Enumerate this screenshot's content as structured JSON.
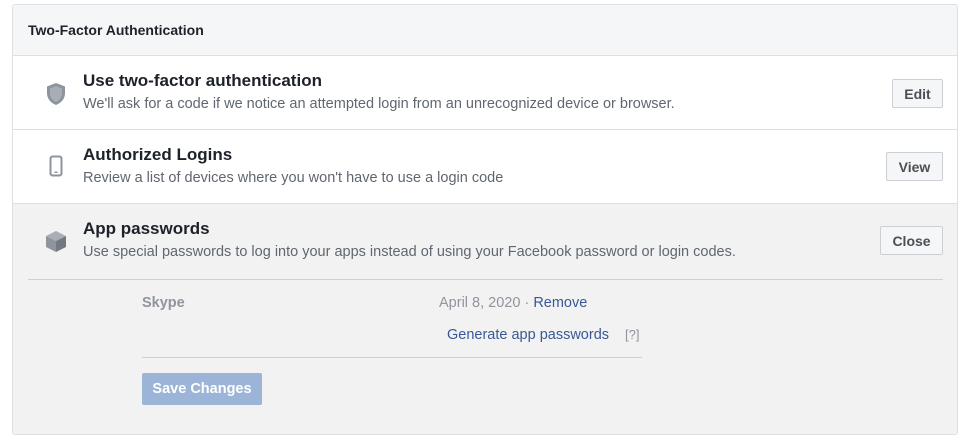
{
  "panel": {
    "title": "Two-Factor Authentication"
  },
  "rows": [
    {
      "icon": "shield-icon",
      "title": "Use two-factor authentication",
      "description": "We'll ask for a code if we notice an attempted login from an unrecognized device or browser.",
      "button": "Edit"
    },
    {
      "icon": "phone-icon",
      "title": "Authorized Logins",
      "description": "Review a list of devices where you won't have to use a login code",
      "button": "View"
    },
    {
      "icon": "cube-icon",
      "title": "App passwords",
      "description": "Use special passwords to log into your apps instead of using your Facebook password or login codes.",
      "button": "Close"
    }
  ],
  "app_passwords": {
    "entries": [
      {
        "name": "Skype",
        "date": "April 8, 2020",
        "separator": " · ",
        "remove_label": "Remove"
      }
    ],
    "generate_label": "Generate app passwords",
    "help_label": "[?]",
    "save_label": "Save Changes"
  },
  "colors": {
    "link": "#385898",
    "save_button_disabled": "#9cb4d8",
    "expanded_background": "#f2f2f2",
    "muted_text": "#90949c"
  }
}
